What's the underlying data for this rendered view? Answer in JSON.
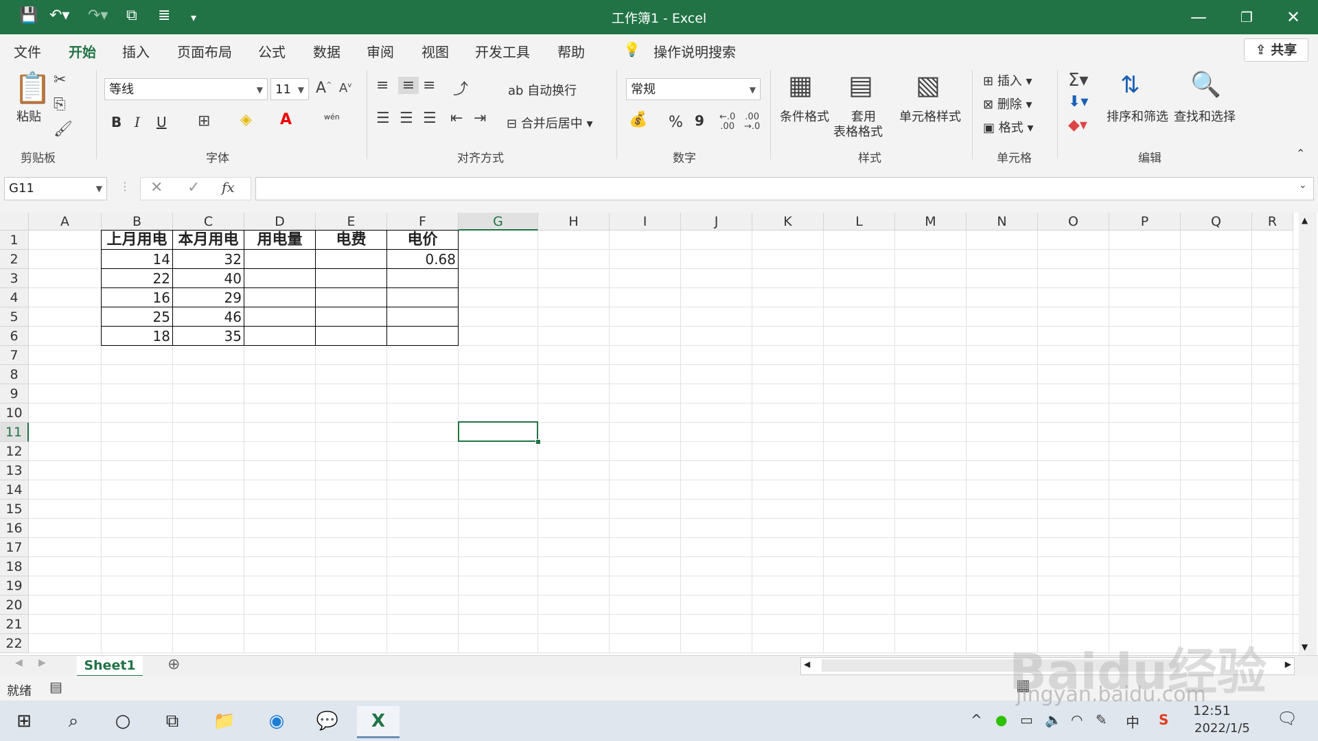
{
  "window": {
    "title": "工作簿1  -  Excel"
  },
  "tabs": [
    "文件",
    "开始",
    "插入",
    "页面布局",
    "公式",
    "数据",
    "审阅",
    "视图",
    "开发工具",
    "帮助"
  ],
  "search_label": "操作说明搜索",
  "share_label": "共享",
  "ribbon": {
    "clipboard": {
      "paste": "粘贴",
      "group": "剪贴板"
    },
    "font": {
      "name": "等线",
      "size": "11",
      "bold": "B",
      "italic": "I",
      "underline": "U",
      "wen": "wén",
      "group": "字体"
    },
    "alignment": {
      "wrap": "自动换行",
      "merge": "合并后居中",
      "group": "对齐方式"
    },
    "number": {
      "format": "常规",
      "percent": "%",
      "comma": "9",
      "inc_dec": "←.0\n.00",
      "dec_dec": ".00\n→.0",
      "group": "数字"
    },
    "styles": {
      "conditional": "条件格式",
      "table1": "套用",
      "table2": "表格格式",
      "cell_styles": "单元格样式",
      "group": "样式"
    },
    "cells": {
      "insert": "插入",
      "delete": "删除",
      "format": "格式",
      "group": "单元格"
    },
    "editing": {
      "sort": "排序和筛选",
      "find": "查找和选择",
      "group": "编辑"
    }
  },
  "formula_bar": {
    "name_box": "G11",
    "fx": "fx",
    "value": ""
  },
  "columns": [
    "A",
    "B",
    "C",
    "D",
    "E",
    "F",
    "G",
    "H",
    "I",
    "J",
    "K",
    "L",
    "M",
    "N",
    "O",
    "P",
    "Q",
    "R"
  ],
  "rows": [
    "1",
    "2",
    "3",
    "4",
    "5",
    "6",
    "7",
    "8",
    "9",
    "10",
    "11",
    "12",
    "13",
    "14",
    "15",
    "16",
    "17",
    "18",
    "19",
    "20",
    "21",
    "22"
  ],
  "selected_cell": "G11",
  "table": {
    "headers": [
      "上月用电",
      "本月用电",
      "用电量",
      "电费",
      "电价"
    ],
    "rows": [
      [
        "14",
        "32",
        "",
        "",
        "0.68"
      ],
      [
        "22",
        "40",
        "",
        "",
        ""
      ],
      [
        "16",
        "29",
        "",
        "",
        ""
      ],
      [
        "25",
        "46",
        "",
        "",
        ""
      ],
      [
        "18",
        "35",
        "",
        "",
        ""
      ]
    ]
  },
  "sheet_tab": "Sheet1",
  "status": {
    "ready": "就绪"
  },
  "taskbar": {
    "time": "12:51",
    "date": "2022/1/5",
    "ime": "中"
  },
  "watermark": {
    "main": "Baidu经验",
    "url": "jingyan.baidu.com"
  },
  "colors": {
    "excel_green": "#217346",
    "selection": "#217346"
  }
}
